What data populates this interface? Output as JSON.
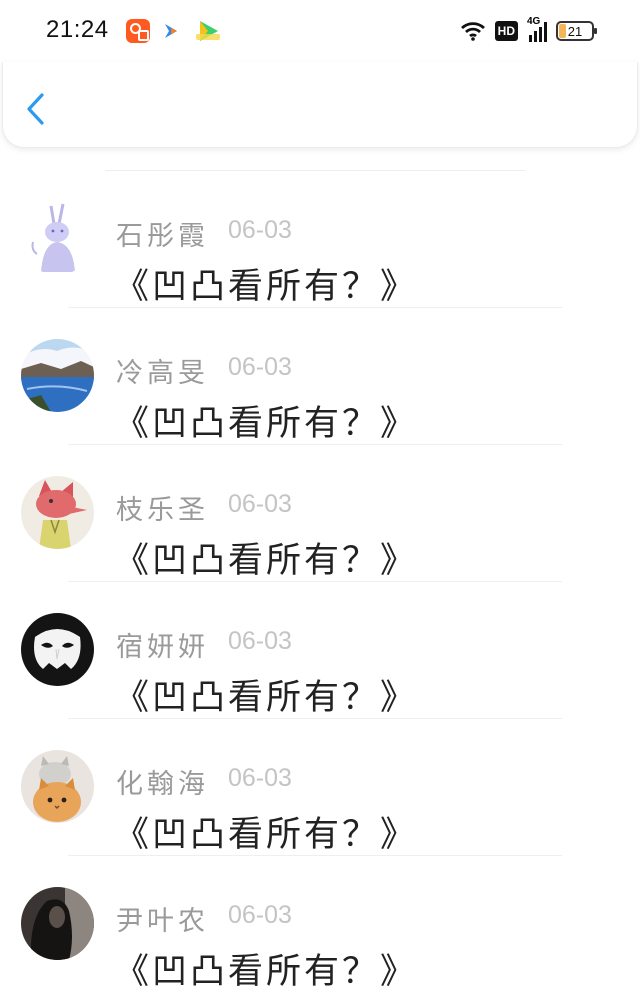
{
  "status_bar": {
    "time": "21:24",
    "hd_label": "HD",
    "network_label": "4G",
    "battery_level": "21",
    "apps": [
      "kuaishou-icon",
      "arrow-app-icon",
      "video-app-icon"
    ]
  },
  "nav": {
    "back_icon": "chevron-left-icon",
    "accent_color": "#2a9bf0"
  },
  "comments": [
    {
      "name": "石彤霞",
      "date": "06-03",
      "text": "《凹凸看所有？》",
      "avatar": "rabbit-sketch-avatar"
    },
    {
      "name": "冷高旻",
      "date": "06-03",
      "text": "《凹凸看所有？》",
      "avatar": "lake-landscape-avatar"
    },
    {
      "name": "枝乐圣",
      "date": "06-03",
      "text": "《凹凸看所有？》",
      "avatar": "fox-cartoon-avatar"
    },
    {
      "name": "宿妍妍",
      "date": "06-03",
      "text": "《凹凸看所有？》",
      "avatar": "mask-avatar"
    },
    {
      "name": "化翰海",
      "date": "06-03",
      "text": "《凹凸看所有？》",
      "avatar": "cats-avatar"
    },
    {
      "name": "尹叶农",
      "date": "06-03",
      "text": "《凹凸看所有？》",
      "avatar": "dark-portrait-avatar"
    }
  ]
}
